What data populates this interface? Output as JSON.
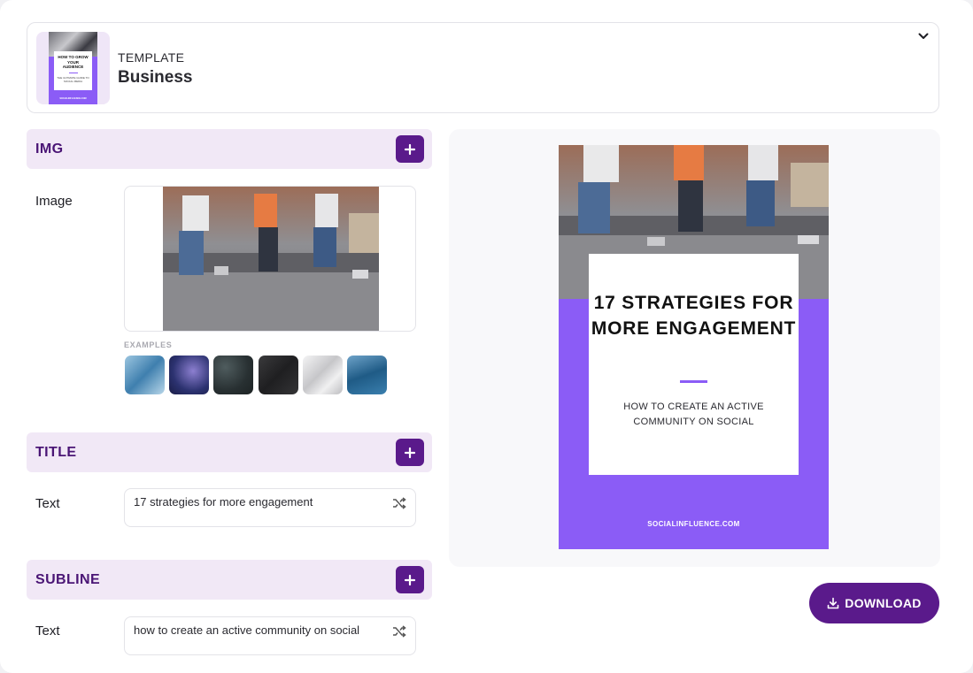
{
  "template": {
    "label": "TEMPLATE",
    "name": "Business",
    "thumbnail_title": "HOW TO GROW YOUR AUDIENCE",
    "thumbnail_sub": "THE ULTIMATE GUIDE TO SOCIAL MEDIA"
  },
  "sections": {
    "img": {
      "title": "IMG",
      "field_label": "Image",
      "examples_label": "EXAMPLES",
      "examples": [
        {
          "name": "blue-ice",
          "color": "#6aa3c8"
        },
        {
          "name": "galaxy",
          "color": "#3a3f8a"
        },
        {
          "name": "dark-pebbles",
          "color": "#2f3638"
        },
        {
          "name": "cracked-slate",
          "color": "#2b2b2d"
        },
        {
          "name": "white-silk",
          "color": "#e2e2e4"
        },
        {
          "name": "ocean-waves",
          "color": "#2f6f9a"
        }
      ]
    },
    "title": {
      "title": "TITLE",
      "field_label": "Text",
      "value": "17 strategies for more engagement"
    },
    "subline": {
      "title": "SUBLINE",
      "field_label": "Text",
      "value": "how to create an active community on social"
    }
  },
  "preview": {
    "title": "17 STRATEGIES FOR MORE ENGAGEMENT",
    "subline": "HOW TO CREATE AN ACTIVE COMMUNITY ON SOCIAL",
    "footer": "SOCIALINFLUENCE.COM",
    "accent": "#8b5cf6"
  },
  "download": {
    "label": "DOWNLOAD"
  },
  "colors": {
    "brand": "#5a1a8b",
    "section_bg": "#f1e8f6",
    "section_title": "#4a1575"
  }
}
